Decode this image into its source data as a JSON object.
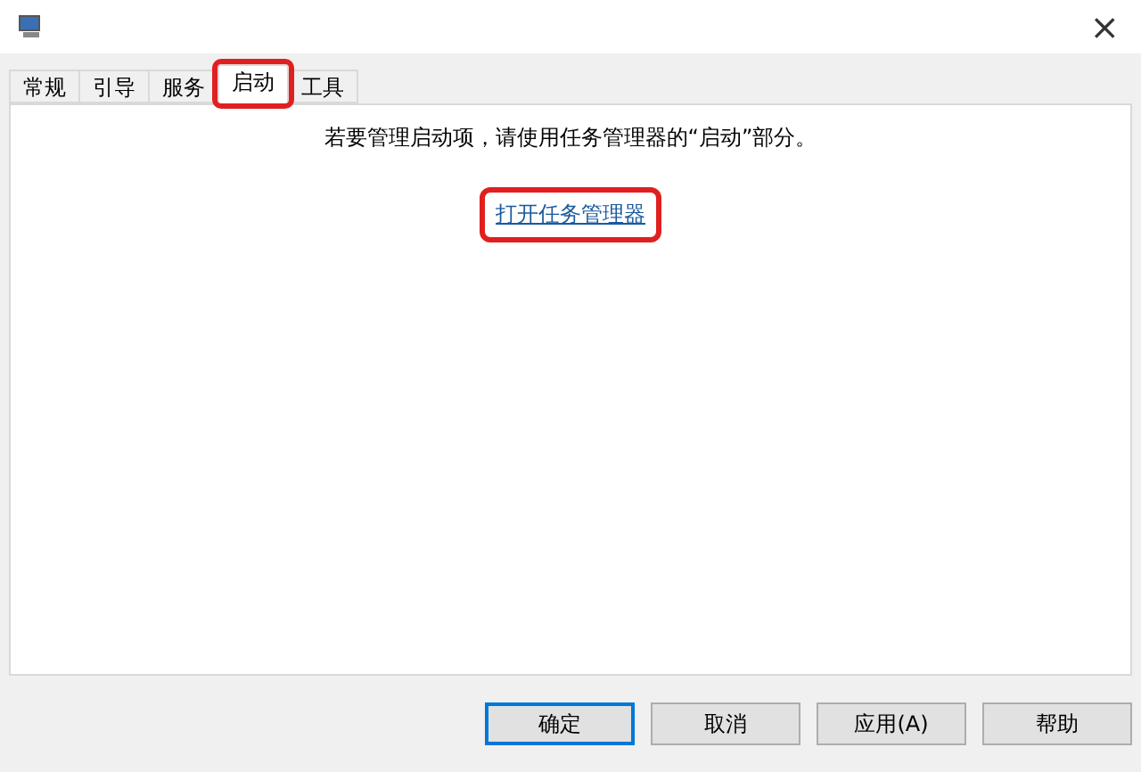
{
  "window": {
    "close": "×"
  },
  "tabs": [
    {
      "label": "常规",
      "selected": false,
      "highlighted": false
    },
    {
      "label": "引导",
      "selected": false,
      "highlighted": false
    },
    {
      "label": "服务",
      "selected": false,
      "highlighted": false
    },
    {
      "label": "启动",
      "selected": true,
      "highlighted": true
    },
    {
      "label": "工具",
      "selected": false,
      "highlighted": false
    }
  ],
  "panel": {
    "message": "若要管理启动项，请使用任务管理器的“启动”部分。",
    "link": {
      "label": "打开任务管理器",
      "highlighted": true
    }
  },
  "buttons": [
    {
      "label": "确定",
      "default": true
    },
    {
      "label": "取消",
      "default": false
    },
    {
      "label": "应用(A)",
      "default": false
    },
    {
      "label": "帮助",
      "default": false
    }
  ]
}
